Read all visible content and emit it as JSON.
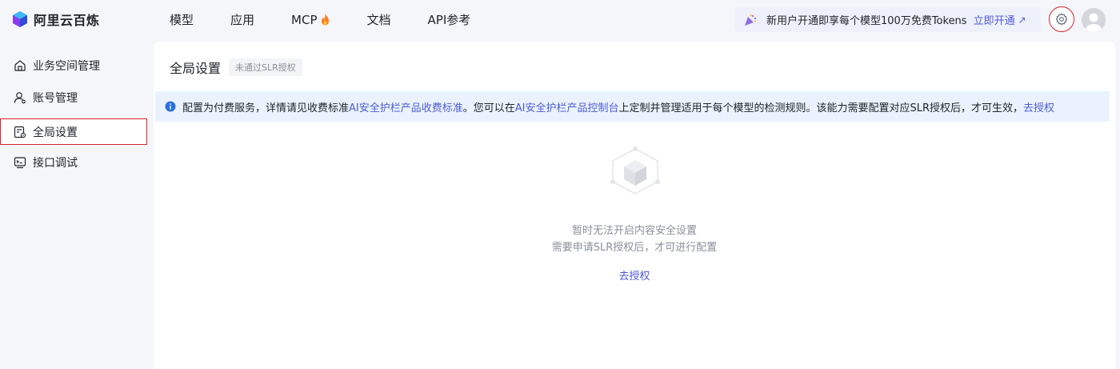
{
  "brand": {
    "name": "阿里云百炼"
  },
  "nav": {
    "items": [
      {
        "label": "模型"
      },
      {
        "label": "应用"
      },
      {
        "label": "MCP"
      },
      {
        "label": "文档"
      },
      {
        "label": "API参考"
      }
    ],
    "mcp_badge_icon": "fire-icon"
  },
  "promo": {
    "text": "新用户开通即享每个模型100万免费Tokens",
    "cta": "立即开通",
    "cta_arrow": "↗"
  },
  "sidebar": {
    "items": [
      {
        "label": "业务空间管理",
        "icon": "home-icon"
      },
      {
        "label": "账号管理",
        "icon": "user-icon"
      },
      {
        "label": "全局设置",
        "icon": "settings-doc-icon",
        "active": true
      },
      {
        "label": "接口调试",
        "icon": "terminal-icon"
      }
    ]
  },
  "main": {
    "title": "全局设置",
    "tag": "未通过SLR授权",
    "notice": {
      "part1": "配置为付费服务，详情请见收费标准",
      "link1": "AI安全护栏产品收费标准",
      "part2": "。您可以在",
      "link2": "AI安全护栏产品控制台",
      "part3": "上定制并管理适用于每个模型的检测规则。该能力需要配置对应SLR授权后，才可生效，",
      "link3": "去授权"
    },
    "empty": {
      "line1": "暂时无法开启内容安全设置",
      "line2": "需要申请SLR授权后，才可进行配置",
      "action": "去授权"
    }
  },
  "colors": {
    "accent": "#4f5bd5",
    "highlight_border": "#d8242e",
    "notice_bg": "#eaf3fd",
    "page_bg": "#f5f6f9"
  }
}
